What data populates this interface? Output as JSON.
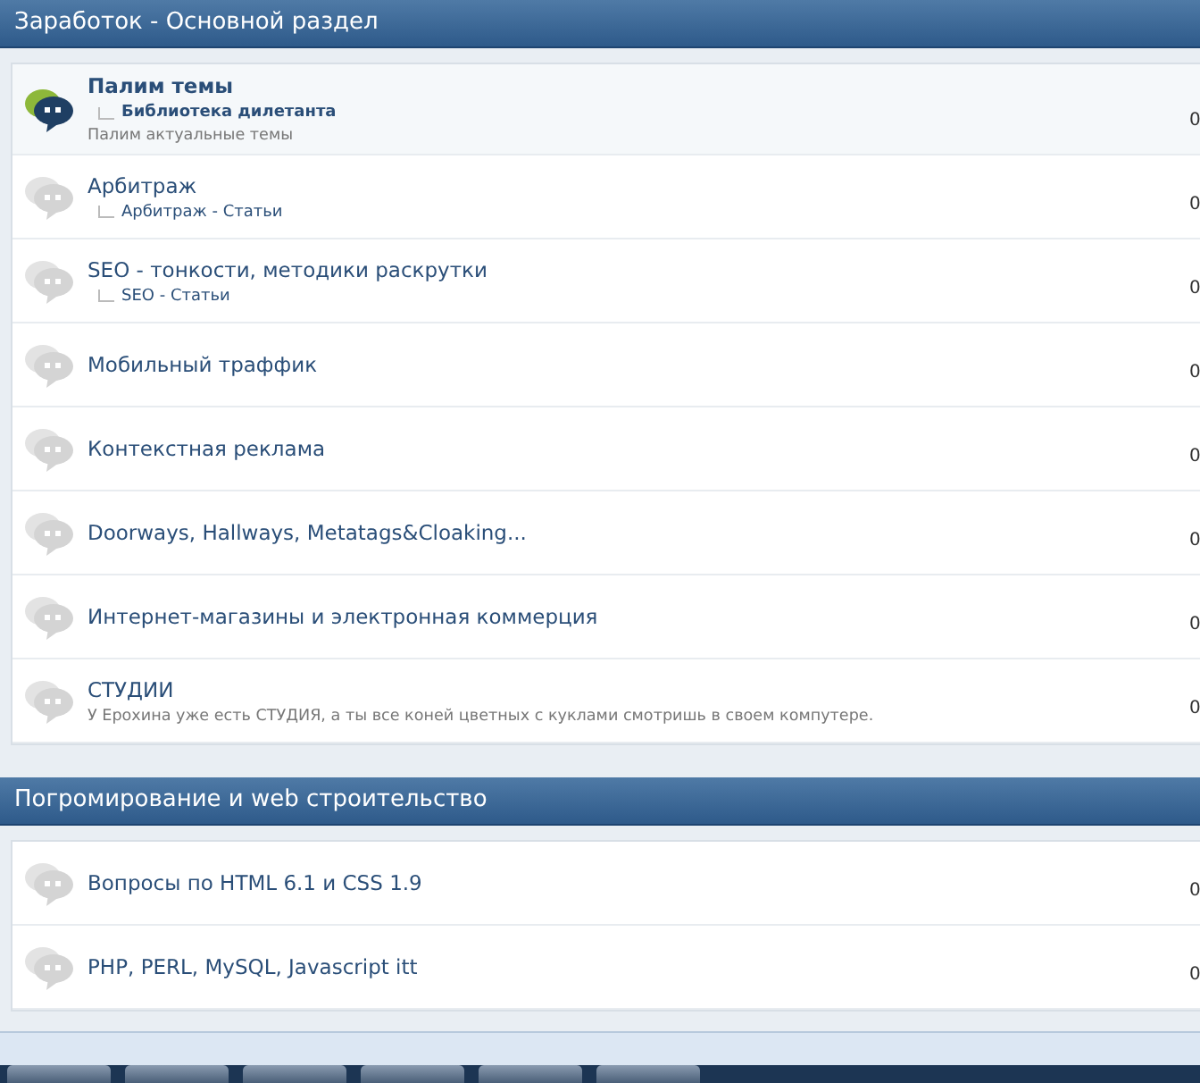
{
  "sections": [
    {
      "title": "Заработок - Основной раздел",
      "forums": [
        {
          "title": "Палим темы",
          "unread": true,
          "subforums": [
            "Библиотека дилетанта"
          ],
          "description": "Палим актуальные темы",
          "count": "0"
        },
        {
          "title": "Арбитраж",
          "unread": false,
          "subforums": [
            "Арбитраж - Статьи"
          ],
          "count": "0"
        },
        {
          "title": "SEO - тонкости, методики раскрутки",
          "unread": false,
          "subforums": [
            "SEO - Статьи"
          ],
          "count": "0"
        },
        {
          "title": "Мобильный траффик",
          "unread": false,
          "count": "0"
        },
        {
          "title": "Контекстная реклама",
          "unread": false,
          "count": "0"
        },
        {
          "title": "Doorways, Hallways, Metatags&Cloaking...",
          "unread": false,
          "count": "0"
        },
        {
          "title": "Интернет-магазины и электронная коммерция",
          "unread": false,
          "count": "0"
        },
        {
          "title": "СТУДИИ",
          "unread": false,
          "description": "У Ерохина уже есть СТУДИЯ, а ты все коней цветных с куклами смотришь в своем компутере.",
          "count": "0"
        }
      ]
    },
    {
      "title": "Погромирование и web строительство",
      "forums": [
        {
          "title": "Вопросы по HTML 6.1 и CSS 1.9",
          "unread": false,
          "count": "0"
        },
        {
          "title": "PHP, PERL, MySQL, Javascript itt",
          "unread": false,
          "count": "0"
        }
      ]
    }
  ]
}
